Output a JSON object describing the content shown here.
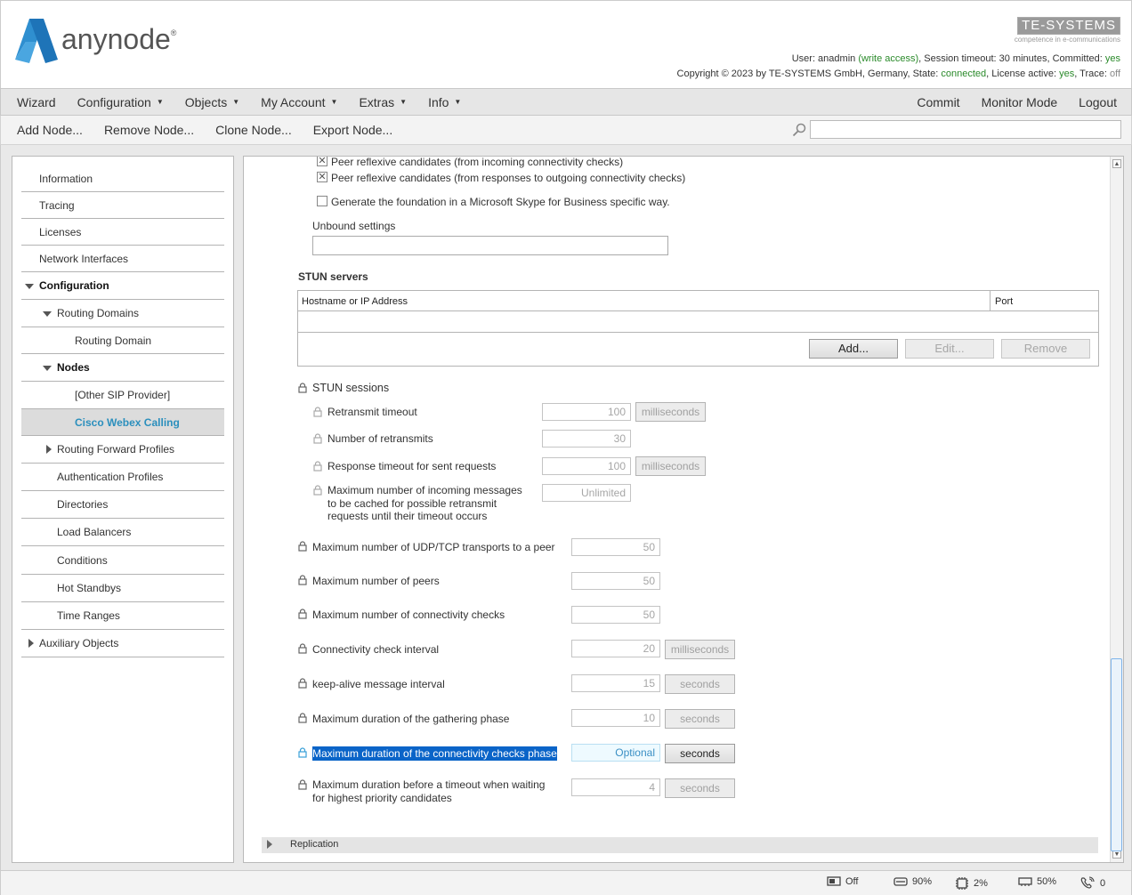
{
  "app": {
    "logo_text": "anynode",
    "logo_reg": "®",
    "brand_name": "TE-SYSTEMS",
    "brand_tagline": "competence in e-communications"
  },
  "status": {
    "user_label": "User: anadmin",
    "access": "(write access)",
    "session": ", Session timeout: 30 minutes, Committed: ",
    "committed": "yes",
    "copyright": "Copyright © 2023 by TE-SYSTEMS GmbH, Germany, State: ",
    "state": "connected",
    "license_label": ", License active: ",
    "license": "yes",
    "trace_label": ", Trace: ",
    "trace": "off"
  },
  "menu": {
    "left": [
      "Wizard",
      "Configuration",
      "Objects",
      "My Account",
      "Extras",
      "Info"
    ],
    "right": [
      "Commit",
      "Monitor Mode",
      "Logout"
    ]
  },
  "toolbar": [
    "Add Node...",
    "Remove Node...",
    "Clone Node...",
    "Export Node..."
  ],
  "search": {
    "placeholder": ""
  },
  "sidebar": {
    "information": "Information",
    "tracing": "Tracing",
    "licenses": "Licenses",
    "network_interfaces": "Network Interfaces",
    "configuration": "Configuration",
    "routing_domains": "Routing Domains",
    "routing_domain": "Routing Domain",
    "nodes": "Nodes",
    "other_sip": "[Other SIP Provider]",
    "cisco_webex": "Cisco Webex Calling",
    "routing_forward": "Routing Forward Profiles",
    "auth_profiles": "Authentication Profiles",
    "directories": "Directories",
    "load_balancers": "Load Balancers",
    "conditions": "Conditions",
    "hot_standbys": "Hot Standbys",
    "time_ranges": "Time Ranges",
    "auxiliary": "Auxiliary Objects"
  },
  "content": {
    "peer_incoming": "Peer reflexive candidates (from incoming connectivity checks)",
    "peer_outgoing": "Peer reflexive candidates (from responses to outgoing connectivity checks)",
    "generate_foundation": "Generate the foundation in a Microsoft Skype for Business specific way.",
    "unbound_settings": "Unbound settings",
    "unbound_value": "",
    "stun_servers_title": "STUN servers",
    "col_hostname": "Hostname or IP Address",
    "col_port": "Port",
    "add_button": "Add...",
    "edit_button": "Edit...",
    "remove_button": "Remove",
    "stun_sessions": "STUN sessions",
    "retransmit_timeout": "Retransmit timeout",
    "retransmit_timeout_value": "100",
    "num_retransmits": "Number of retransmits",
    "num_retransmits_value": "30",
    "response_timeout": "Response timeout for sent requests",
    "response_timeout_value": "100",
    "max_incoming_line1": "Maximum number of incoming messages",
    "max_incoming_line2": "to be cached for possible retransmit",
    "max_incoming_line3": "requests until their timeout occurs",
    "max_incoming_value": "Unlimited",
    "unit_ms": "milliseconds",
    "unit_s": "seconds",
    "max_transports": "Maximum number of UDP/TCP transports to a peer",
    "max_transports_value": "50",
    "max_peers": "Maximum number of peers",
    "max_peers_value": "50",
    "max_checks": "Maximum number of connectivity checks",
    "max_checks_value": "50",
    "check_interval": "Connectivity check interval",
    "check_interval_value": "20",
    "keepalive": "keep-alive message interval",
    "keepalive_value": "15",
    "gathering": "Maximum duration of the gathering phase",
    "gathering_value": "10",
    "conn_checks_phase": "Maximum duration of the connectivity checks phase",
    "conn_checks_phase_value": "Optional",
    "timeout_priority_line1": "Maximum duration before a timeout when waiting",
    "timeout_priority_line2": "for highest priority candidates",
    "timeout_priority_value": "4",
    "replication": "Replication"
  },
  "statusbar": {
    "monitor": "Off",
    "disk": "90%",
    "cpu": "2%",
    "memory": "50%",
    "calls": "0"
  }
}
